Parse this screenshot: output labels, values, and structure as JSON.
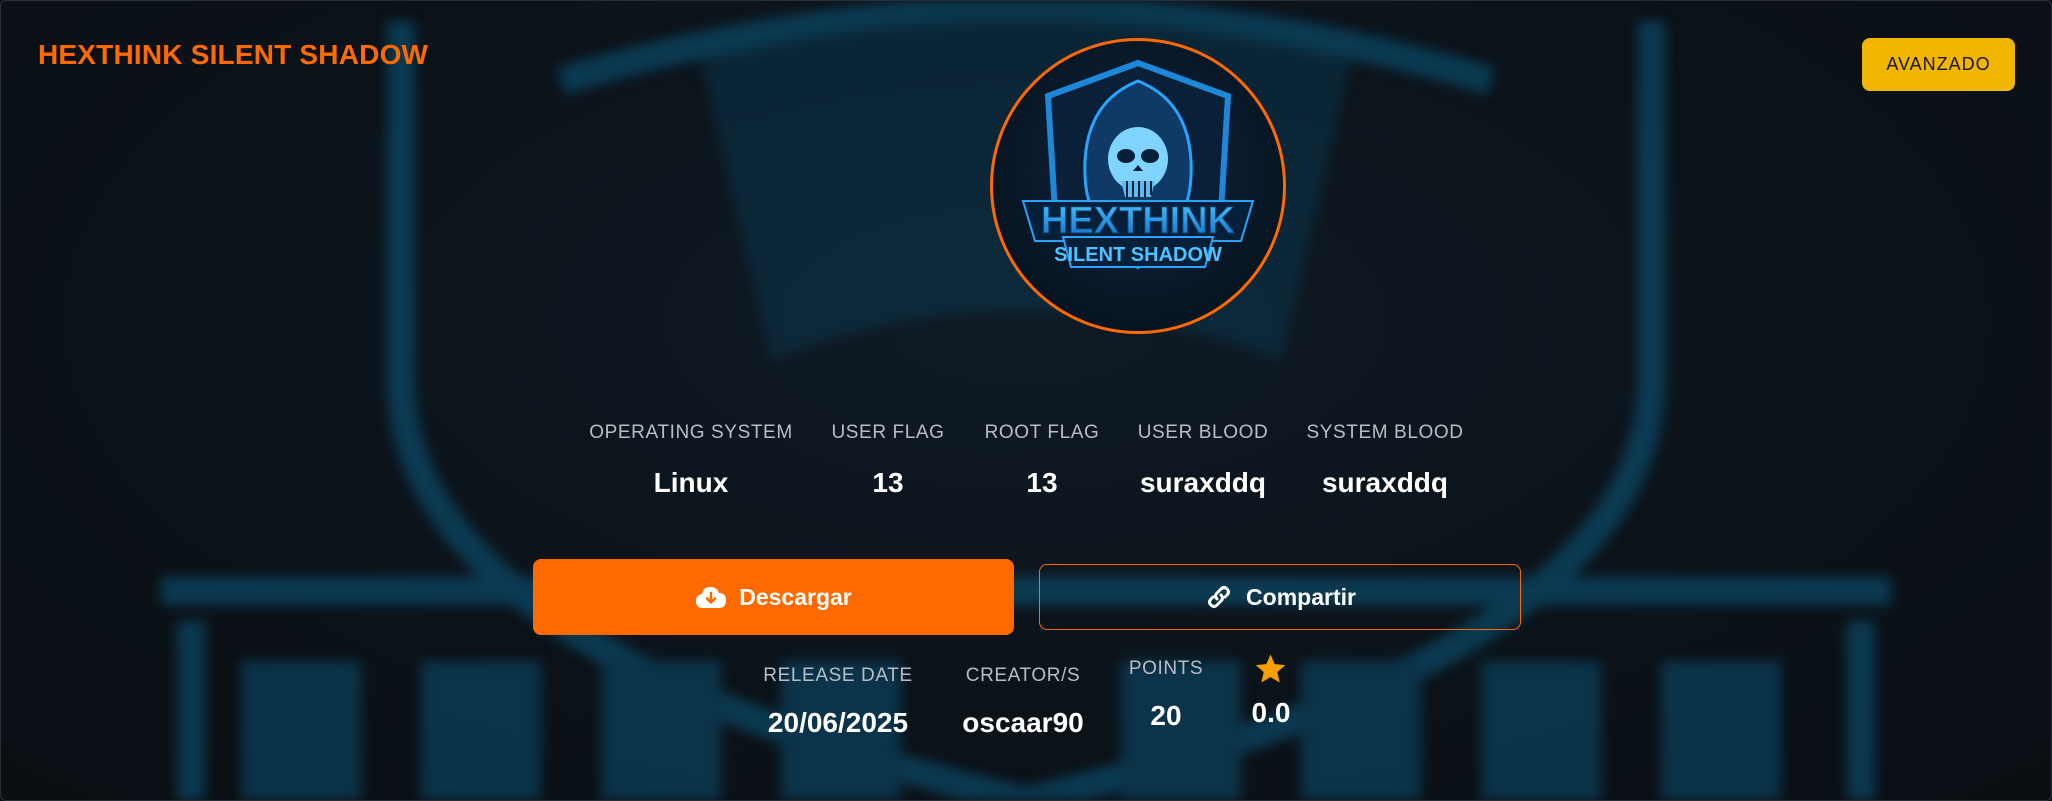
{
  "header": {
    "title": "HEXTHINK SILENT SHADOW",
    "difficulty": "AVANZADO"
  },
  "logo": {
    "line1": "HEXTHINK",
    "line2": "SILENT SHADOW",
    "icon": "hooded-skull-icon"
  },
  "stats": [
    {
      "label": "OPERATING SYSTEM",
      "value": "Linux"
    },
    {
      "label": "USER FLAG",
      "value": "13"
    },
    {
      "label": "ROOT FLAG",
      "value": "13"
    },
    {
      "label": "USER BLOOD",
      "value": "suraxddq"
    },
    {
      "label": "SYSTEM BLOOD",
      "value": "suraxddq"
    }
  ],
  "actions": {
    "download_label": "Descargar",
    "download_icon": "cloud-download-icon",
    "share_label": "Compartir",
    "share_icon": "link-icon"
  },
  "meta": {
    "release_label": "RELEASE DATE",
    "release_value": "20/06/2025",
    "creator_label": "CREATOR/S",
    "creator_value": "oscaar90",
    "points_label": "POINTS",
    "points_value": "20",
    "rating_icon": "star-icon",
    "rating_value": "0.0"
  },
  "colors": {
    "accent": "#ff6a00",
    "badge": "#f1b700",
    "background": "#0b1218",
    "star": "#f5a000"
  }
}
